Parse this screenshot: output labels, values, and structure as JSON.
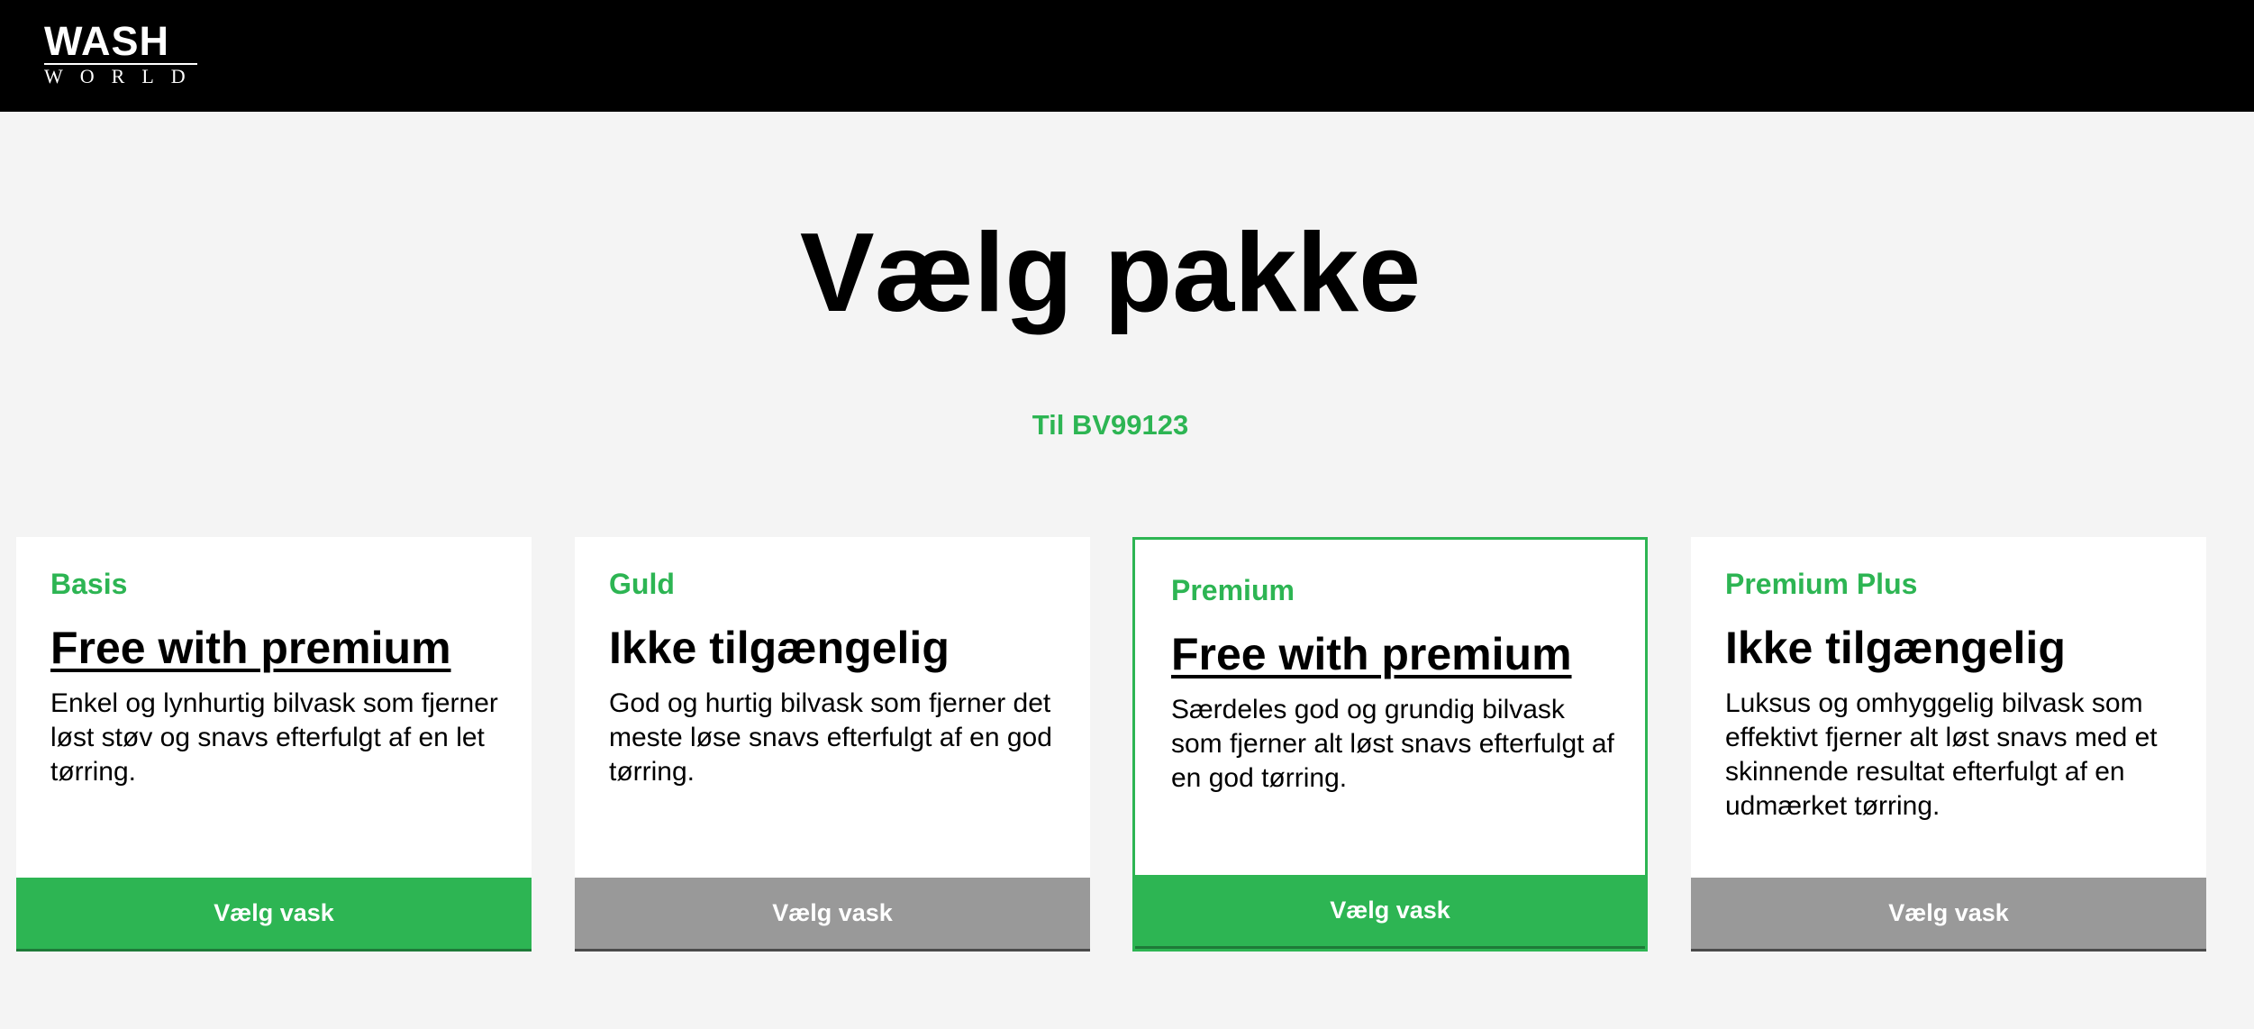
{
  "header": {
    "logo_top": "WASH",
    "logo_bottom": "WORLD"
  },
  "main": {
    "title": "Vælg pakke",
    "subtitle": "Til BV99123"
  },
  "packages": [
    {
      "name": "Basis",
      "price": "Free with premium",
      "description": "Enkel og lynhurtig bilvask som fjerner løst støv og snavs efterfulgt af en let tørring.",
      "button_label": "Vælg vask",
      "available": true,
      "selected": false
    },
    {
      "name": "Guld",
      "price": "Ikke tilgængelig",
      "description": "God og hurtig bilvask som fjerner det meste løse snavs efterfulgt af en god tørring.",
      "button_label": "Vælg vask",
      "available": false,
      "selected": false
    },
    {
      "name": "Premium",
      "price": "Free with premium",
      "description": "Særdeles god og grundig bilvask som fjerner alt løst snavs efterfulgt af en god tørring.",
      "button_label": "Vælg vask",
      "available": true,
      "selected": true
    },
    {
      "name": "Premium Plus",
      "price": "Ikke tilgængelig",
      "description": "Luksus og omhyggelig bilvask som effektivt fjerner alt løst snavs med et skinnende resultat efterfulgt af en udmærket tørring.",
      "button_label": "Vælg vask",
      "available": false,
      "selected": false
    }
  ],
  "colors": {
    "accent": "#2db553",
    "disabled": "#999999",
    "header_bg": "#000000",
    "page_bg": "#f4f4f4"
  }
}
